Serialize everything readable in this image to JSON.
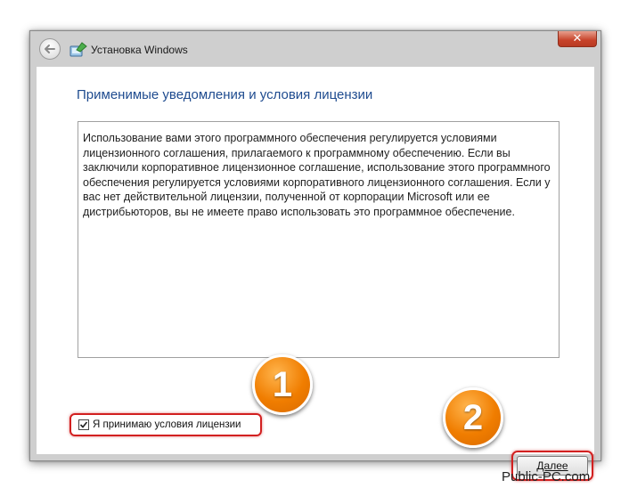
{
  "window": {
    "title": "Установка Windows",
    "close_glyph": "✕"
  },
  "page": {
    "heading": "Применимые уведомления и условия лицензии",
    "license_text": "Использование вами этого программного обеспечения регулируется условиями лицензионного соглашения, прилагаемого к программному обеспечению. Если вы заключили корпоративное лицензионное соглашение, использование этого программного обеспечения регулируется условиями корпоративного лицензионного соглашения. Если у вас нет действительной лицензии, полученной от корпорации Microsoft или ее дистрибьюторов, вы не имеете право использовать это программное обеспечение.",
    "accept_label": "Я принимаю условия лицензии",
    "accept_checked": true,
    "next_button": "Далее"
  },
  "annotations": {
    "badge_1": "1",
    "badge_2": "2"
  },
  "watermark": "Public-PC.com",
  "colors": {
    "heading": "#1e4b8f",
    "highlight": "#d22020",
    "badge": "#f07d00",
    "close_button": "#c7432a"
  },
  "icons": {
    "back": "back-arrow-icon",
    "app": "windows-setup-icon",
    "close": "close-icon",
    "check": "checkmark-icon"
  }
}
